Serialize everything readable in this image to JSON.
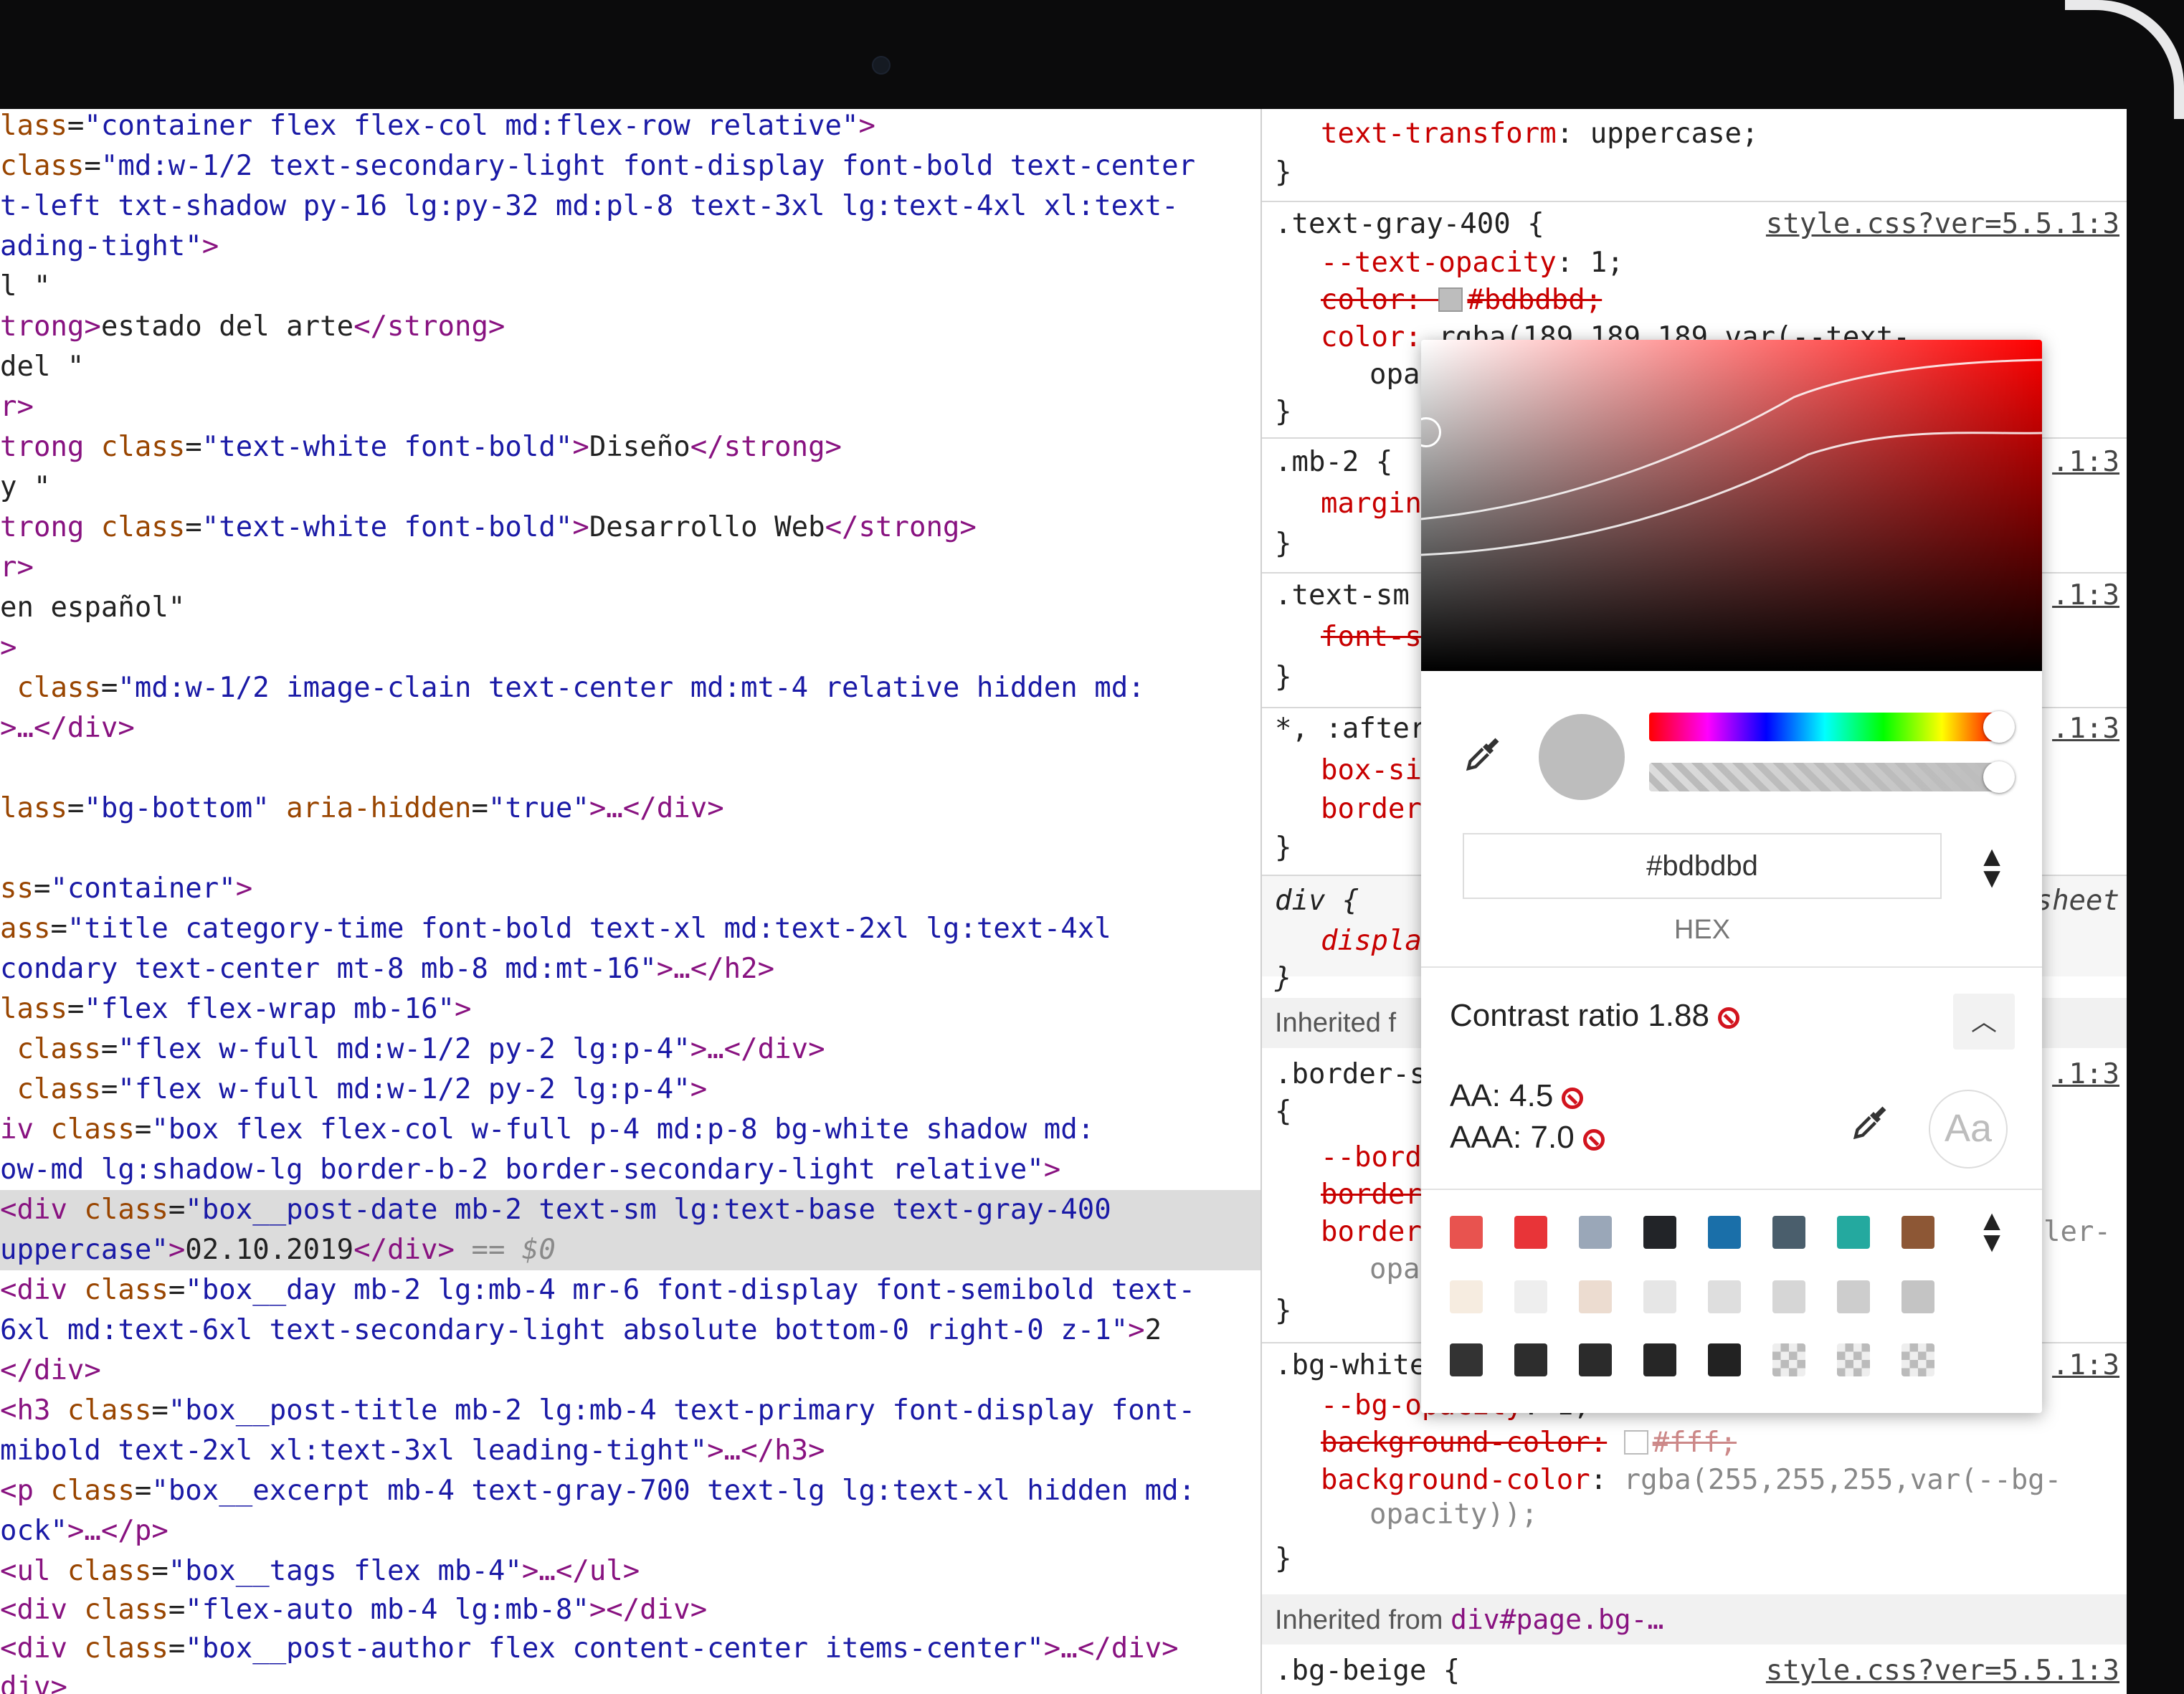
{
  "elements": {
    "lines": [
      {
        "parts": [
          [
            "attr",
            "lass"
          ],
          [
            "txt",
            "="
          ],
          [
            "val",
            "\"container flex flex-col md:flex-row relative\""
          ],
          [
            "tag",
            ">"
          ]
        ]
      },
      {
        "parts": [
          [
            "attr",
            "class"
          ],
          [
            "txt",
            "="
          ],
          [
            "val",
            "\"md:w-1/2 text-secondary-light font-display font-bold text-center"
          ]
        ]
      },
      {
        "parts": [
          [
            "val",
            "t-left txt-shadow py-16 lg:py-32 md:pl-8 text-3xl lg:text-4xl xl:text-"
          ]
        ]
      },
      {
        "parts": [
          [
            "val",
            "ading-tight\""
          ],
          [
            "tag",
            ">"
          ]
        ]
      },
      {
        "parts": [
          [
            "txt",
            "l \""
          ]
        ]
      },
      {
        "parts": [
          [
            "tag",
            "trong>"
          ],
          [
            "txt",
            "estado del arte"
          ],
          [
            "tag",
            "</strong>"
          ]
        ]
      },
      {
        "parts": [
          [
            "txt",
            "del \""
          ]
        ]
      },
      {
        "parts": [
          [
            "tag",
            "r>"
          ]
        ]
      },
      {
        "parts": [
          [
            "tag",
            "trong "
          ],
          [
            "attr",
            "class"
          ],
          [
            "txt",
            "="
          ],
          [
            "val",
            "\"text-white font-bold\""
          ],
          [
            "tag",
            ">"
          ],
          [
            "txt",
            "Diseño"
          ],
          [
            "tag",
            "</strong>"
          ]
        ]
      },
      {
        "parts": [
          [
            "txt",
            "y \""
          ]
        ]
      },
      {
        "parts": [
          [
            "tag",
            "trong "
          ],
          [
            "attr",
            "class"
          ],
          [
            "txt",
            "="
          ],
          [
            "val",
            "\"text-white font-bold\""
          ],
          [
            "tag",
            ">"
          ],
          [
            "txt",
            "Desarrollo Web"
          ],
          [
            "tag",
            "</strong>"
          ]
        ]
      },
      {
        "parts": [
          [
            "tag",
            "r>"
          ]
        ]
      },
      {
        "parts": [
          [
            "txt",
            "en español\""
          ]
        ]
      },
      {
        "parts": [
          [
            "tag",
            ">"
          ]
        ]
      },
      {
        "parts": [
          [
            "attr",
            " class"
          ],
          [
            "txt",
            "="
          ],
          [
            "val",
            "\"md:w-1/2 image-clain text-center md:mt-4 relative hidden md:"
          ]
        ]
      },
      {
        "parts": [
          [
            "tag",
            ">…</div>"
          ]
        ]
      },
      {
        "parts": []
      },
      {
        "parts": [
          [
            "attr",
            "lass"
          ],
          [
            "txt",
            "="
          ],
          [
            "val",
            "\"bg-bottom\""
          ],
          [
            "attr",
            " aria-hidden"
          ],
          [
            "txt",
            "="
          ],
          [
            "val",
            "\"true\""
          ],
          [
            "tag",
            ">…</div>"
          ]
        ]
      },
      {
        "parts": []
      },
      {
        "parts": [
          [
            "attr",
            "ss"
          ],
          [
            "txt",
            "="
          ],
          [
            "val",
            "\"container\""
          ],
          [
            "tag",
            ">"
          ]
        ]
      },
      {
        "parts": [
          [
            "attr",
            "ass"
          ],
          [
            "txt",
            "="
          ],
          [
            "val",
            "\"title category-time font-bold text-xl md:text-2xl lg:text-4xl"
          ]
        ]
      },
      {
        "parts": [
          [
            "val",
            "condary text-center mt-8 mb-8 md:mt-16\""
          ],
          [
            "tag",
            ">…</h2>"
          ]
        ]
      },
      {
        "parts": [
          [
            "attr",
            "lass"
          ],
          [
            "txt",
            "="
          ],
          [
            "val",
            "\"flex flex-wrap mb-16\""
          ],
          [
            "tag",
            ">"
          ]
        ]
      },
      {
        "parts": [
          [
            "attr",
            " class"
          ],
          [
            "txt",
            "="
          ],
          [
            "val",
            "\"flex w-full md:w-1/2 py-2 lg:p-4\""
          ],
          [
            "tag",
            ">…</div>"
          ]
        ]
      },
      {
        "parts": [
          [
            "attr",
            " class"
          ],
          [
            "txt",
            "="
          ],
          [
            "val",
            "\"flex w-full md:w-1/2 py-2 lg:p-4\""
          ],
          [
            "tag",
            ">"
          ]
        ]
      },
      {
        "parts": [
          [
            "tag",
            "iv "
          ],
          [
            "attr",
            "class"
          ],
          [
            "txt",
            "="
          ],
          [
            "val",
            "\"box flex flex-col w-full p-4 md:p-8 bg-white shadow md:"
          ]
        ]
      },
      {
        "parts": [
          [
            "val",
            "ow-md lg:shadow-lg border-b-2 border-secondary-light relative\""
          ],
          [
            "tag",
            ">"
          ]
        ]
      },
      {
        "parts": [
          [
            "tag",
            "<div "
          ],
          [
            "attr",
            "class"
          ],
          [
            "txt",
            "="
          ],
          [
            "val",
            "\"box__post-date mb-2 text-sm lg:text-base text-gray-400"
          ]
        ],
        "highlight": true
      },
      {
        "parts": [
          [
            "val",
            "uppercase\""
          ],
          [
            "tag",
            ">"
          ],
          [
            "txt",
            "02.10.2019"
          ],
          [
            "tag",
            "</div>"
          ],
          [
            "dim",
            " == $0"
          ]
        ],
        "highlight": true
      },
      {
        "parts": [
          [
            "tag",
            "<div "
          ],
          [
            "attr",
            "class"
          ],
          [
            "txt",
            "="
          ],
          [
            "val",
            "\"box__day mb-2 lg:mb-4 mr-6 font-display font-semibold text-"
          ]
        ]
      },
      {
        "parts": [
          [
            "val",
            "6xl md:text-6xl text-secondary-light absolute bottom-0 right-0 z-1\""
          ],
          [
            "tag",
            ">"
          ],
          [
            "txt",
            "2"
          ]
        ]
      },
      {
        "parts": [
          [
            "tag",
            "</div>"
          ]
        ]
      },
      {
        "parts": [
          [
            "tag",
            "<h3 "
          ],
          [
            "attr",
            "class"
          ],
          [
            "txt",
            "="
          ],
          [
            "val",
            "\"box__post-title mb-2 lg:mb-4 text-primary font-display font-"
          ]
        ]
      },
      {
        "parts": [
          [
            "val",
            "mibold text-2xl xl:text-3xl leading-tight\""
          ],
          [
            "tag",
            ">…</h3>"
          ]
        ]
      },
      {
        "parts": [
          [
            "tag",
            "<p "
          ],
          [
            "attr",
            "class"
          ],
          [
            "txt",
            "="
          ],
          [
            "val",
            "\"box__excerpt mb-4 text-gray-700 text-lg lg:text-xl hidden md:"
          ]
        ]
      },
      {
        "parts": [
          [
            "val",
            "ock\""
          ],
          [
            "tag",
            ">…</p>"
          ]
        ]
      },
      {
        "parts": [
          [
            "tag",
            "<ul "
          ],
          [
            "attr",
            "class"
          ],
          [
            "txt",
            "="
          ],
          [
            "val",
            "\"box__tags flex mb-4\""
          ],
          [
            "tag",
            ">…</ul>"
          ]
        ]
      },
      {
        "parts": [
          [
            "tag",
            "<div "
          ],
          [
            "attr",
            "class"
          ],
          [
            "txt",
            "="
          ],
          [
            "val",
            "\"flex-auto mb-4 lg:mb-8\""
          ],
          [
            "tag",
            "></div>"
          ]
        ]
      },
      {
        "parts": [
          [
            "tag",
            "<div "
          ],
          [
            "attr",
            "class"
          ],
          [
            "txt",
            "="
          ],
          [
            "val",
            "\"box__post-author flex content-center items-center\""
          ],
          [
            "tag",
            ">…</div>"
          ]
        ]
      },
      {
        "parts": [
          [
            "tag",
            "div>"
          ]
        ]
      }
    ]
  },
  "styles": {
    "rule0": {
      "prop": "text-transform",
      "value": "uppercase;"
    },
    "close_brace": "}",
    "rule1": {
      "selector": ".text-gray-400 {",
      "link": "style.css?ver=5.5.1:3",
      "l1prop": "--text-opacity",
      "l1val": "1;",
      "l2": "color: ",
      "l2val": "#bdbdbd;",
      "l3": "color:",
      "l3rest": "rgba(189,189,189,var(--text-",
      "l4": "opa"
    },
    "rule2": {
      "selector": ".mb-2 {",
      "link": ".1:3",
      "prop": "margin"
    },
    "rule3": {
      "selector": ".text-sm",
      "link": ".1:3",
      "prop": "font-s"
    },
    "rule4": {
      "selector": "*, :after",
      "link": ".1:3",
      "p1": "box-si",
      "p2": "border"
    },
    "rule5": {
      "selector": "div {",
      "link": "sheet",
      "prop": "displa"
    },
    "inherited1": "Inherited f",
    "rule6": {
      "selector": ".border-s",
      "brace": "{",
      "link": ".1:3",
      "p1": "--bord",
      "p2": "border",
      "p3": "border",
      "p3tail": "ler-",
      "p4": "opa"
    },
    "rule7": {
      "selector": ".bg-white",
      "link": ".1:3",
      "p1": "--bg-opacity",
      "v1": "1;",
      "p2": "background-color:",
      "v2": "#fff;",
      "p3": "background-color",
      "v3": "rgba(255,255,255,var(--bg-",
      "v3b": "opacity));"
    },
    "inherited2": {
      "label": "Inherited from ",
      "node": "div#page.bg-…"
    },
    "rule8": {
      "selector": ".bg-beige {",
      "link": "style.css?ver=5.5.1:3"
    }
  },
  "picker": {
    "hex_value": "#bdbdbd",
    "format_label": "HEX",
    "contrast_label": "Contrast ratio 1.88",
    "aa_label": "AA: 4.5",
    "aaa_label": "AAA: 7.0",
    "aa_preview": "Aa",
    "current_color": "#bdbdbd",
    "palette_row1": [
      "#e8534f",
      "#e83438",
      "#9aa7b8",
      "#222428",
      "#1a6fa9",
      "#4a5e6c",
      "#24a99f",
      "#8d5735"
    ],
    "palette_row2": [
      "#f6ece0",
      "#eeeeee",
      "#ecdcd0",
      "#e6e6e6",
      "#dedede",
      "#d6d6d6",
      "#cdcdcd",
      "#c4c4c4"
    ],
    "palette_row3": [
      "#333333",
      "#2d2d2d",
      "#2b2b2b",
      "#262626",
      "#222222",
      "checker",
      "checker",
      "checker"
    ]
  }
}
